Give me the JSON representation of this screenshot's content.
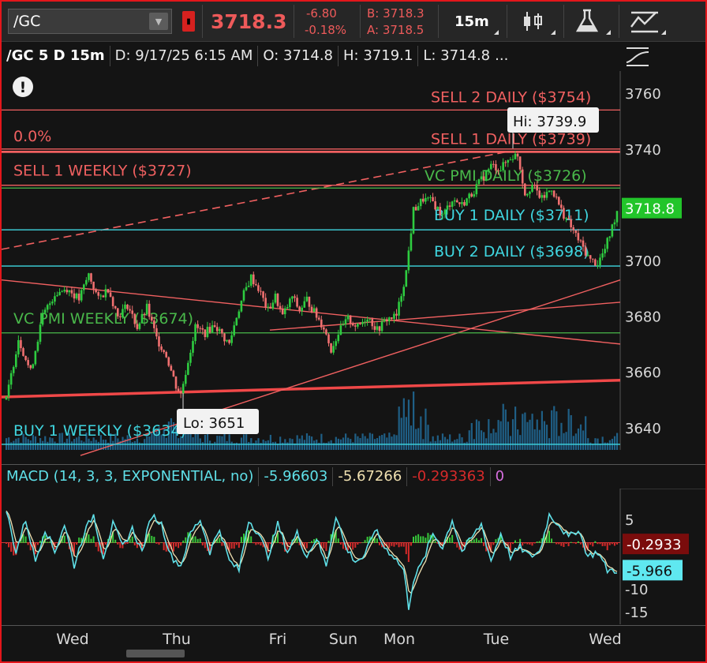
{
  "toolbar": {
    "symbol": "/GC",
    "last_price": "3718.3",
    "net_change": "-6.80",
    "pct_change": "-0.18%",
    "bid": "B: 3718.3",
    "ask": "A: 3718.5",
    "interval": "15m"
  },
  "header": {
    "title": "/GC 5 D 15m",
    "date": "D: 9/17/25 6:15 AM",
    "open": "O: 3714.8",
    "high": "H: 3719.1",
    "low": "L: 3714.8",
    "more": "..."
  },
  "colors": {
    "up": "#2ecc40",
    "down": "#f07070",
    "resistance": "#f06060",
    "support": "#3fd6e0",
    "vcpmi": "#49b84a",
    "volume": "#1f5f86",
    "macd": "#5fe0e8",
    "signal": "#f0e0b0"
  },
  "chart_data": [
    {
      "type": "candlestick",
      "title": "/GC 5 D 15m",
      "ylim": [
        3632,
        3768
      ],
      "y_ticks": [
        3640,
        3660,
        3680,
        3700,
        3720,
        3740,
        3760
      ],
      "x_ticks": [
        "Wed",
        "Thu",
        "Fri",
        "Sun",
        "Mon",
        "Tue",
        "Wed"
      ],
      "current_price": "3718.8",
      "high_label": "Hi: 3739.9",
      "low_label": "Lo: 3651",
      "fib_label": "0.0%",
      "levels": [
        {
          "label": "SELL 2 DAILY ($3754)",
          "value": 3754,
          "kind": "resistance"
        },
        {
          "label": "SELL 1 DAILY ($3739)",
          "value": 3739,
          "kind": "resistance"
        },
        {
          "label": "SELL 1 WEEKLY ($3727)",
          "value": 3727,
          "kind": "resistance"
        },
        {
          "label": "VC PMI DAILY ($3726)",
          "value": 3726,
          "kind": "vcpmi"
        },
        {
          "label": "BUY 1 DAILY ($3711)",
          "value": 3711,
          "kind": "support"
        },
        {
          "label": "BUY 2 DAILY ($3698)",
          "value": 3698,
          "kind": "support"
        },
        {
          "label": "VC PMI WEEKLY ($3674)",
          "value": 3674,
          "kind": "vcpmi"
        },
        {
          "label": "BUY 1 WEEKLY ($3634)",
          "value": 3634,
          "kind": "support"
        }
      ],
      "price_path": [
        [
          0,
          3650
        ],
        [
          5,
          3672
        ],
        [
          10,
          3660
        ],
        [
          15,
          3680
        ],
        [
          20,
          3688
        ],
        [
          25,
          3690
        ],
        [
          30,
          3686
        ],
        [
          34,
          3695
        ],
        [
          38,
          3686
        ],
        [
          42,
          3690
        ],
        [
          46,
          3680
        ],
        [
          50,
          3684
        ],
        [
          54,
          3676
        ],
        [
          58,
          3683
        ],
        [
          62,
          3672
        ],
        [
          66,
          3666
        ],
        [
          70,
          3655
        ],
        [
          72,
          3652
        ],
        [
          74,
          3660
        ],
        [
          78,
          3676
        ],
        [
          82,
          3674
        ],
        [
          86,
          3677
        ],
        [
          90,
          3672
        ],
        [
          92,
          3670
        ],
        [
          95,
          3680
        ],
        [
          98,
          3688
        ],
        [
          101,
          3694
        ],
        [
          104,
          3690
        ],
        [
          108,
          3682
        ],
        [
          111,
          3687
        ],
        [
          114,
          3680
        ],
        [
          118,
          3687
        ],
        [
          121,
          3682
        ],
        [
          124,
          3686
        ],
        [
          128,
          3680
        ],
        [
          131,
          3676
        ],
        [
          134,
          3668
        ],
        [
          137,
          3674
        ],
        [
          141,
          3679
        ],
        [
          145,
          3676
        ],
        [
          149,
          3680
        ],
        [
          153,
          3675
        ],
        [
          157,
          3679
        ],
        [
          161,
          3680
        ],
        [
          165,
          3696
        ],
        [
          168,
          3718
        ],
        [
          172,
          3722
        ],
        [
          176,
          3721
        ],
        [
          180,
          3716
        ],
        [
          184,
          3722
        ],
        [
          188,
          3720
        ],
        [
          192,
          3724
        ],
        [
          196,
          3729
        ],
        [
          200,
          3734
        ],
        [
          204,
          3733
        ],
        [
          208,
          3737
        ],
        [
          211,
          3738
        ],
        [
          214,
          3724
        ],
        [
          217,
          3727
        ],
        [
          221,
          3722
        ],
        [
          225,
          3726
        ],
        [
          229,
          3718
        ],
        [
          233,
          3712
        ],
        [
          237,
          3706
        ],
        [
          241,
          3700
        ],
        [
          244,
          3699
        ],
        [
          247,
          3704
        ],
        [
          250,
          3712
        ],
        [
          252,
          3718
        ]
      ]
    },
    {
      "type": "line",
      "title": "MACD (14, 3, 3, EXPONENTIAL, no)",
      "ylim": [
        -16,
        10
      ],
      "y_ticks": [
        5,
        -10,
        -15
      ],
      "series": [
        {
          "name": "MACD",
          "value": "-5.96603",
          "last": "-5.966"
        },
        {
          "name": "Signal",
          "value": "-5.67266"
        },
        {
          "name": "Diff",
          "value": "-0.293363",
          "last": "-0.2933"
        },
        {
          "name": "ZeroLine",
          "value": "0"
        }
      ],
      "macd_path": [
        [
          0,
          7
        ],
        [
          4,
          -2
        ],
        [
          8,
          5
        ],
        [
          12,
          -4
        ],
        [
          16,
          3
        ],
        [
          20,
          -2
        ],
        [
          24,
          4
        ],
        [
          28,
          -5
        ],
        [
          32,
          2
        ],
        [
          36,
          6
        ],
        [
          40,
          -3
        ],
        [
          44,
          4
        ],
        [
          48,
          -1
        ],
        [
          52,
          3
        ],
        [
          56,
          -2
        ],
        [
          60,
          6
        ],
        [
          64,
          4
        ],
        [
          68,
          -3
        ],
        [
          72,
          -5
        ],
        [
          76,
          2
        ],
        [
          80,
          5
        ],
        [
          84,
          -2
        ],
        [
          88,
          3
        ],
        [
          92,
          -4
        ],
        [
          96,
          -6
        ],
        [
          100,
          5
        ],
        [
          104,
          2
        ],
        [
          108,
          -3
        ],
        [
          112,
          4
        ],
        [
          116,
          -2
        ],
        [
          120,
          2
        ],
        [
          124,
          -3
        ],
        [
          128,
          1
        ],
        [
          132,
          -5
        ],
        [
          136,
          6
        ],
        [
          140,
          -1
        ],
        [
          144,
          -4
        ],
        [
          148,
          -3
        ],
        [
          152,
          3
        ],
        [
          156,
          -1
        ],
        [
          160,
          -3
        ],
        [
          164,
          -6
        ],
        [
          166,
          -14
        ],
        [
          168,
          -8
        ],
        [
          172,
          -4
        ],
        [
          176,
          2
        ],
        [
          180,
          -1
        ],
        [
          184,
          5
        ],
        [
          188,
          -2
        ],
        [
          192,
          1
        ],
        [
          196,
          4
        ],
        [
          200,
          -4
        ],
        [
          204,
          2
        ],
        [
          208,
          -3
        ],
        [
          212,
          -1
        ],
        [
          216,
          -3
        ],
        [
          220,
          -2
        ],
        [
          224,
          6
        ],
        [
          228,
          4
        ],
        [
          232,
          1
        ],
        [
          236,
          3
        ],
        [
          240,
          -3
        ],
        [
          244,
          -2
        ],
        [
          248,
          -6
        ],
        [
          252,
          -6
        ]
      ]
    }
  ]
}
